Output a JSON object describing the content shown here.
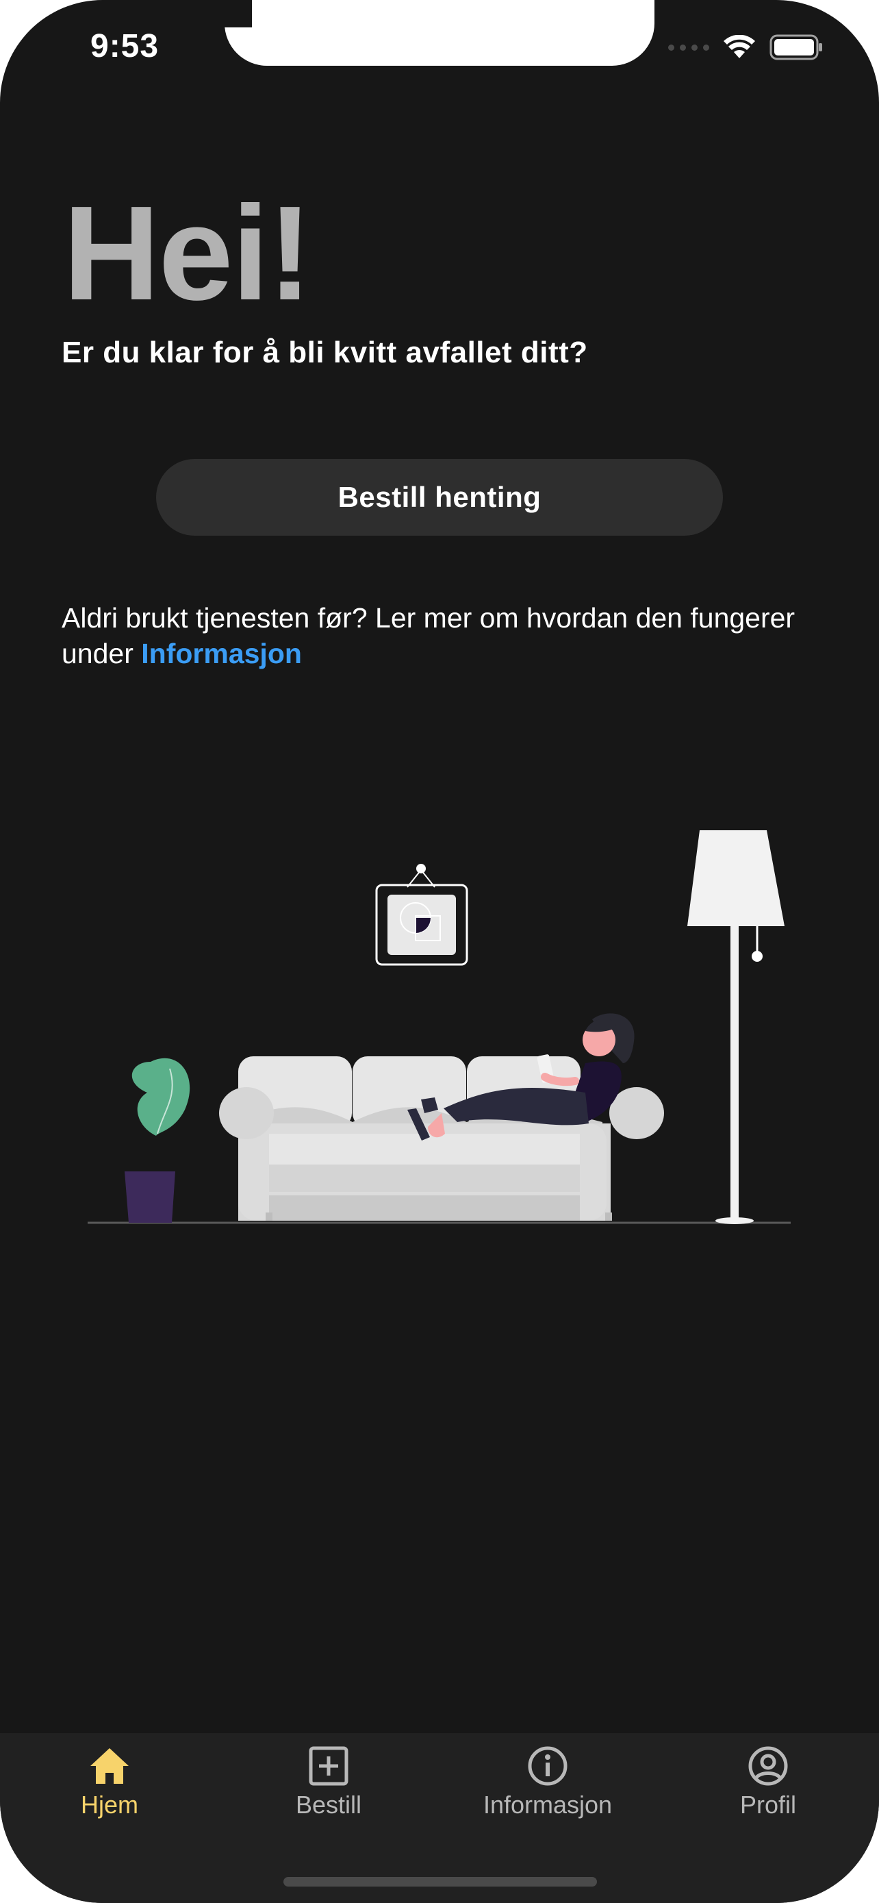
{
  "status_bar": {
    "time": "9:53"
  },
  "home": {
    "greeting": "Hei!",
    "subtitle": "Er du klar for å bli kvitt avfallet ditt?",
    "cta_label": "Bestill henting",
    "info_text": "Aldri brukt tjenesten før? Ler mer om hvordan den fungerer under",
    "info_link": "Informasjon"
  },
  "tabs": [
    {
      "label": "Hjem",
      "icon": "home-icon",
      "active": true
    },
    {
      "label": "Bestill",
      "icon": "plus-square-icon",
      "active": false
    },
    {
      "label": "Informasjon",
      "icon": "info-icon",
      "active": false
    },
    {
      "label": "Profil",
      "icon": "user-circle-icon",
      "active": false
    }
  ],
  "colors": {
    "background": "#171717",
    "tab_active": "#f7d36b",
    "link": "#3b9df5",
    "button": "#2e2e2e"
  }
}
